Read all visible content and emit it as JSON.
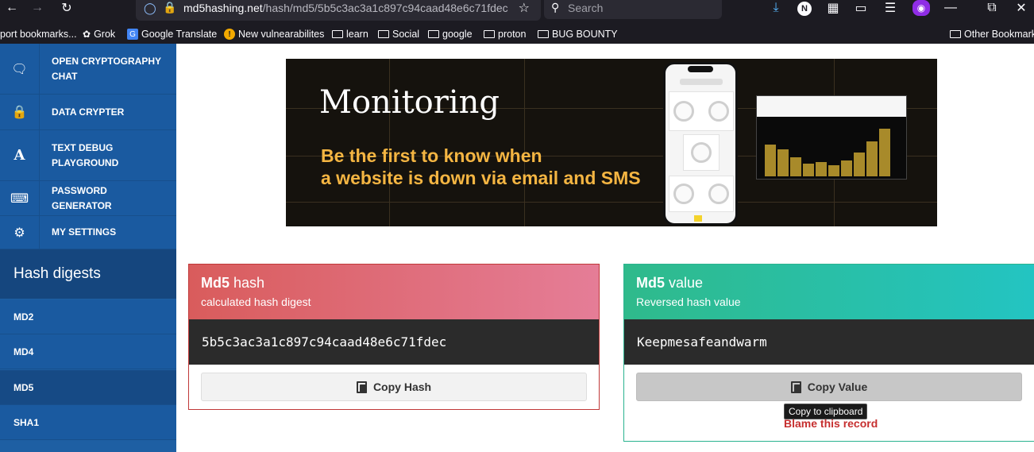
{
  "browser": {
    "url_domain": "md5hashing.net",
    "url_path": "/hash/md5/5b5c3ac3a1c897c94caad48e6c71fdec",
    "search_placeholder": "Search",
    "profile_initial": "N"
  },
  "bookmarks": [
    {
      "label": "port bookmarks...",
      "icon": "none"
    },
    {
      "label": "Grok",
      "icon": "grok-icon"
    },
    {
      "label": "Google Translate",
      "icon": "google-translate-icon"
    },
    {
      "label": "New vulnearabilites",
      "icon": "warning-icon"
    },
    {
      "label": "learn",
      "icon": "folder-icon"
    },
    {
      "label": "Social",
      "icon": "folder-icon"
    },
    {
      "label": "google",
      "icon": "folder-icon"
    },
    {
      "label": "proton",
      "icon": "folder-icon"
    },
    {
      "label": "BUG BOUNTY",
      "icon": "folder-icon"
    }
  ],
  "other_bookmarks": "Other Bookmarks",
  "sidebar": {
    "items": [
      {
        "label": "OPEN CRYPTOGRAPHY CHAT",
        "icon": "chat-icon"
      },
      {
        "label": "DATA CRYPTER",
        "icon": "lock-icon"
      },
      {
        "label": "TEXT DEBUG PLAYGROUND",
        "icon": "font-icon"
      },
      {
        "label": "PASSWORD GENERATOR",
        "icon": "keyboard-icon"
      },
      {
        "label": "MY SETTINGS",
        "icon": "gear-icon"
      }
    ],
    "section_title": "Hash digests",
    "hash_items": [
      "MD2",
      "MD4",
      "MD5",
      "SHA1"
    ],
    "active_hash": "MD5"
  },
  "banner": {
    "title": "Monitoring",
    "subtitle_line1": "Be the first to know when",
    "subtitle_line2": "a website is down via email and SMS"
  },
  "hash_card": {
    "title_bold": "Md5",
    "title_rest": " hash",
    "subtitle": "calculated hash digest",
    "value": "5b5c3ac3a1c897c94caad48e6c71fdec",
    "button": "Copy Hash"
  },
  "value_card": {
    "title_bold": "Md5",
    "title_rest": " value",
    "subtitle": "Reversed hash value",
    "value": "Keepmesafeandwarm",
    "button": "Copy Value",
    "tooltip": "Copy to clipboard",
    "blame_link": "Blame this record"
  },
  "colors": {
    "sidebar": "#1e5fa3",
    "hash_card_accent": "#d95c5c",
    "value_card_accent": "#2fba8b",
    "banner_accent": "#f4b542"
  }
}
